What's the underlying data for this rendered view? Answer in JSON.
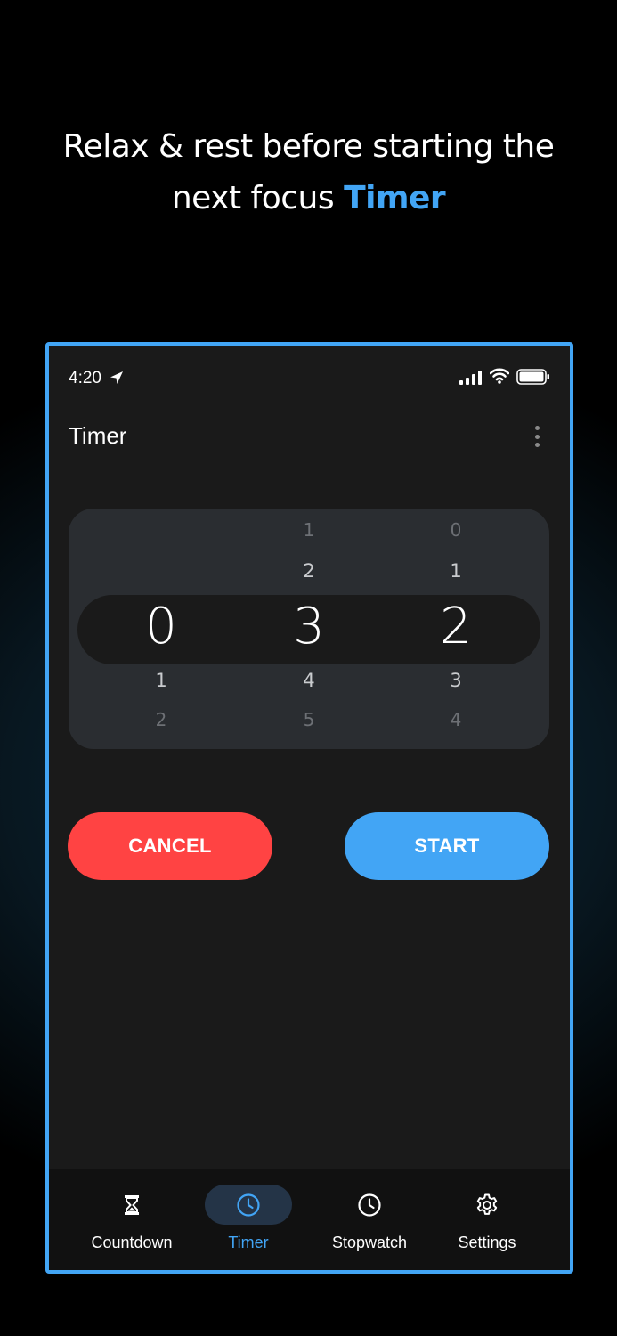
{
  "headline": {
    "line1": "Relax & rest before starting the",
    "line2_prefix": "next focus ",
    "line2_accent": "Timer"
  },
  "status_bar": {
    "time": "4:20"
  },
  "app_bar": {
    "title": "Timer"
  },
  "picker": {
    "hours": {
      "above_far": "",
      "above_near": "",
      "selected": "0",
      "below_near": "1",
      "below_far": "2"
    },
    "minutes": {
      "above_far": "1",
      "above_near": "2",
      "selected": "3",
      "below_near": "4",
      "below_far": "5"
    },
    "seconds": {
      "above_far": "0",
      "above_near": "1",
      "selected": "2",
      "below_near": "3",
      "below_far": "4"
    }
  },
  "actions": {
    "cancel_label": "CANCEL",
    "start_label": "START"
  },
  "bottom_nav": {
    "items": [
      {
        "label": "Countdown",
        "icon": "hourglass-icon"
      },
      {
        "label": "Timer",
        "icon": "clock-icon",
        "active": true
      },
      {
        "label": "Stopwatch",
        "icon": "clock-icon"
      },
      {
        "label": "Settings",
        "icon": "gear-icon"
      }
    ]
  },
  "colors": {
    "accent": "#42a5f5",
    "cancel": "#ff4343",
    "surface": "#1a1a1a",
    "picker_bg": "#2a2d31"
  }
}
